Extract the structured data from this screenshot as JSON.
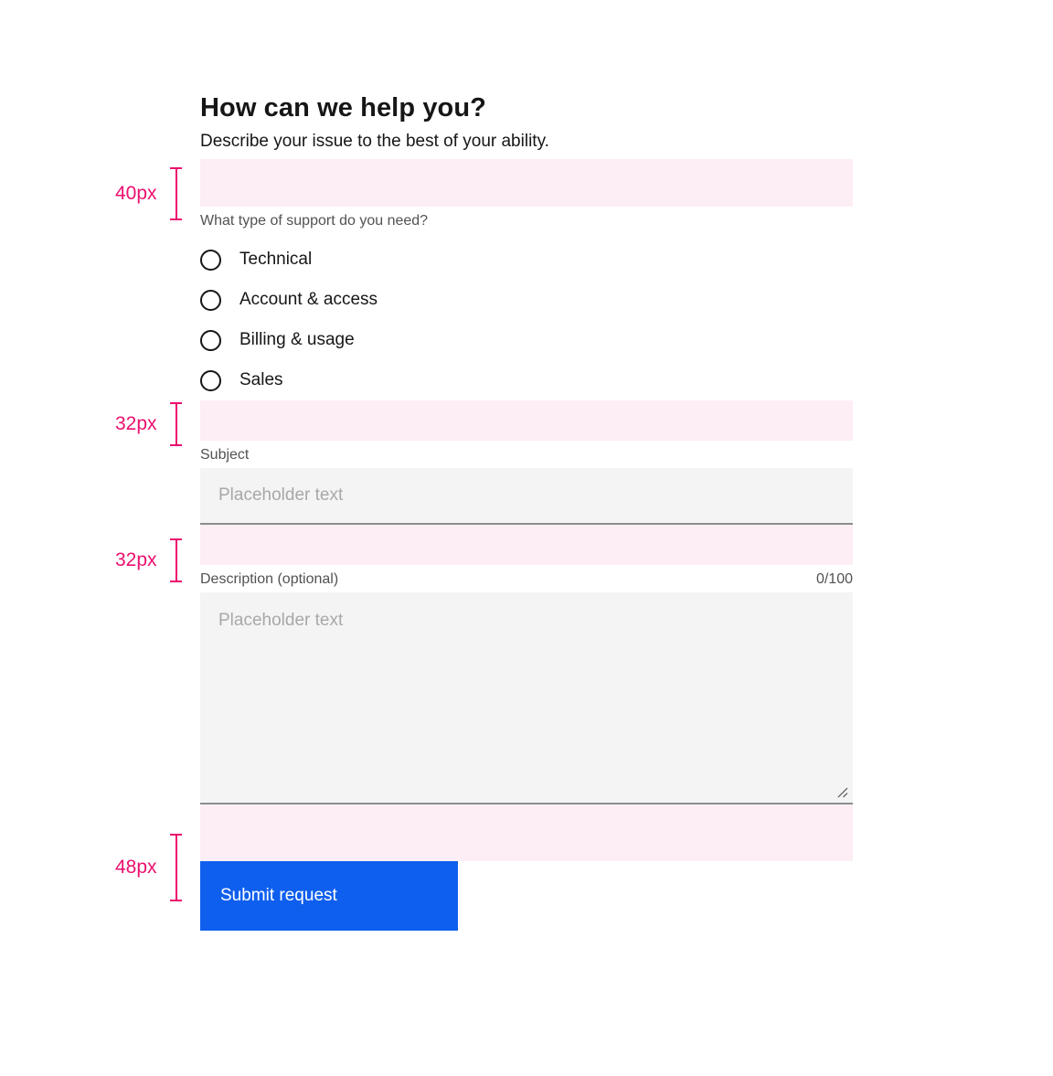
{
  "header": {
    "title": "How can we help you?",
    "subtitle": "Describe your issue to the best of your ability."
  },
  "radio_group": {
    "legend": "What type of support do you need?",
    "options": [
      {
        "label": "Technical",
        "selected": false
      },
      {
        "label": "Account & access",
        "selected": false
      },
      {
        "label": "Billing & usage",
        "selected": false
      },
      {
        "label": "Sales",
        "selected": false
      }
    ]
  },
  "subject_field": {
    "label": "Subject",
    "value": "",
    "placeholder": "Placeholder text"
  },
  "description_field": {
    "label": "Description (optional)",
    "counter": "0/100",
    "value": "",
    "placeholder": "Placeholder text",
    "resize_handle_icon": "resize-corner-icon"
  },
  "actions": {
    "submit_label": "Submit request"
  },
  "annotations": [
    {
      "id": "spacer-above-support-question",
      "text": "40px"
    },
    {
      "id": "spacer-above-subject",
      "text": "32px"
    },
    {
      "id": "spacer-above-description",
      "text": "32px"
    },
    {
      "id": "spacer-above-submit",
      "text": "48px"
    }
  ],
  "colors": {
    "accent_blue": "#0f5fee",
    "annotation_magenta": "#eb0f6e",
    "spacer_pink": "#fdeef5",
    "field_gray": "#f4f4f4",
    "field_border": "#8d8d8d",
    "text_primary": "#161616",
    "text_secondary": "#525252",
    "placeholder": "#a8a8a8"
  }
}
